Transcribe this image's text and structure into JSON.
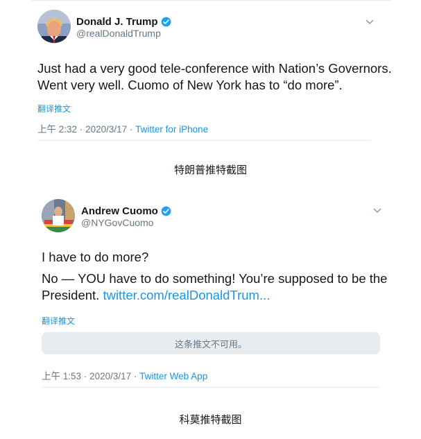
{
  "tweet1": {
    "name": "Donald J. Trump",
    "handle": "@realDonaldTrump",
    "text_line1": "Just had a  very good tele-conference with Nation’s Governors.",
    "text_line2": "Went very well. Cuomo of New York has to “do more”.",
    "translate": "翻译推文",
    "time": "上午 2:32",
    "sep1": "·",
    "date": "2020/3/17",
    "sep2": "·",
    "source": "Twitter for iPhone"
  },
  "caption1": "特朗普推特截图",
  "tweet2": {
    "name": "Andrew Cuomo",
    "handle": "@NYGovCuomo",
    "text_line1": "I have to do more?",
    "text_line2": "No — YOU have to do something!  You’re supposed to be the",
    "text_line3": "President. ",
    "link": "twitter.com/realDonaldTrum...",
    "translate": "翻译推文",
    "unavailable": "这条推文不可用。",
    "time": "上午 1:53",
    "sep1": "·",
    "date": "2020/3/17",
    "sep2": "·",
    "source": "Twitter Web App"
  },
  "caption2": "科莫推特截图",
  "icons": {
    "verified": "verified-badge-icon",
    "more": "chevron-down-icon"
  },
  "colors": {
    "link": "#1b95e0",
    "secondary": "#657786",
    "divider": "#e6ecf0",
    "primary": "#14171a"
  }
}
